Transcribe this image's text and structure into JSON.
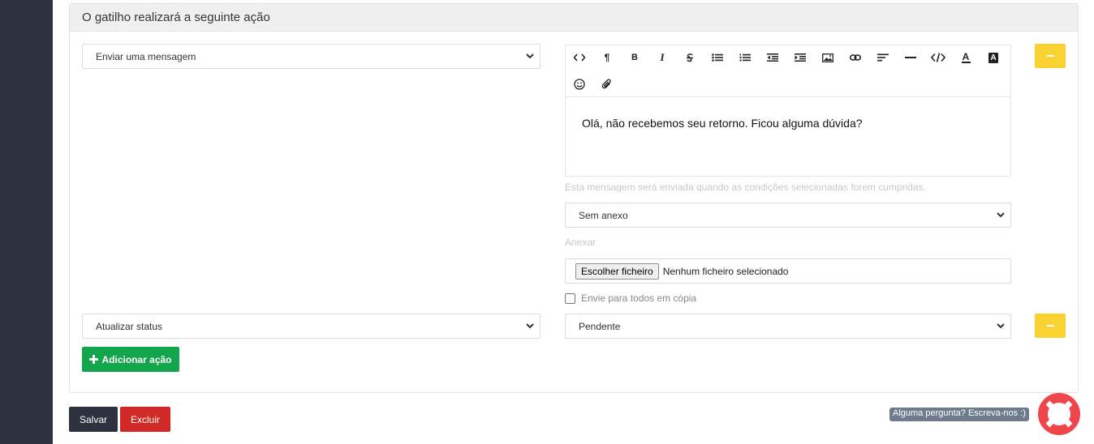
{
  "card": {
    "header_title": "O gatilho realizará a seguinte ação"
  },
  "actions": [
    {
      "type_value": "Enviar uma mensagem"
    },
    {
      "type_value": "Atualizar status",
      "status_value": "Pendente"
    }
  ],
  "editor": {
    "toolbar_icons": [
      "code-view-icon",
      "paragraph-icon",
      "bold-icon",
      "italic-icon",
      "strikethrough-icon",
      "unordered-list-icon",
      "ordered-list-icon",
      "outdent-icon",
      "indent-icon",
      "image-icon",
      "link-icon",
      "align-icon",
      "horizontal-rule-icon",
      "code-icon",
      "font-color-icon",
      "highlight-color-icon",
      "emoji-icon",
      "attachment-icon"
    ],
    "bold_glyph": "B",
    "italic_glyph": "I",
    "paragraph_glyph": "¶",
    "font_color_glyph": "A",
    "highlight_glyph": "A",
    "content": "Olá, não recebemos seu retorno. Ficou alguma dúvida?",
    "hint": "Esta mensagem será enviada quando as condições selecionadas forem cumpridas."
  },
  "attachment": {
    "select_value": "Sem anexo",
    "label": "Anexar",
    "file_button": "Escolher ficheiro",
    "file_status": "Nenhum ficheiro selecionado",
    "cc_label": "Envie para todos em cópia"
  },
  "buttons": {
    "add_action": "Adicionar ação",
    "save": "Salvar",
    "delete": "Excluir"
  },
  "help": {
    "bubble_text": "Alguma pergunta? Escreva-nos :)"
  },
  "colors": {
    "sidebar": "#2d323e",
    "minus_button": "#f9d231",
    "add_button": "#13a54b",
    "save_button": "#2d323e",
    "delete_button": "#d12a26",
    "lifebuoy_red": "#f0464b"
  }
}
